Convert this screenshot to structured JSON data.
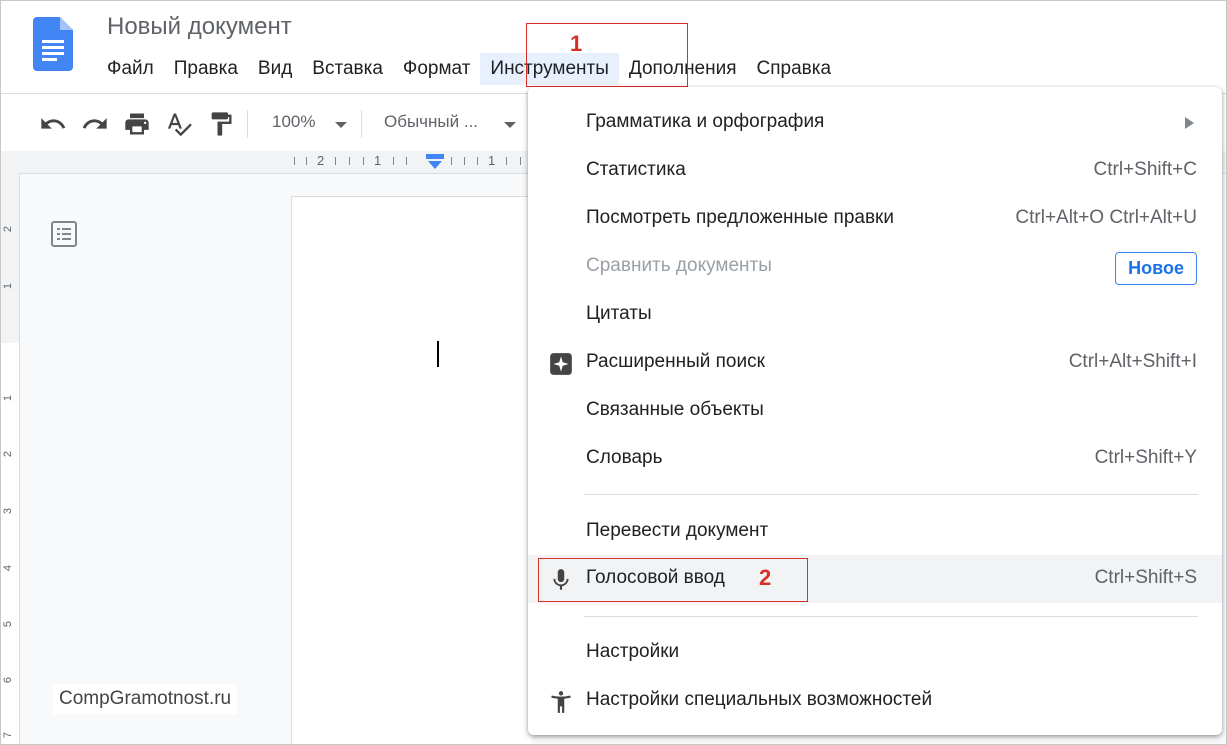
{
  "document": {
    "title": "Новый документ"
  },
  "menubar": {
    "items": [
      {
        "label": "Файл"
      },
      {
        "label": "Правка"
      },
      {
        "label": "Вид"
      },
      {
        "label": "Вставка"
      },
      {
        "label": "Формат"
      },
      {
        "label": "Инструменты",
        "active": true
      },
      {
        "label": "Дополнения"
      },
      {
        "label": "Справка"
      }
    ]
  },
  "annotations": {
    "marker1": "1",
    "marker2": "2",
    "color": "#d93025"
  },
  "toolbar": {
    "zoom": "100%",
    "style": "Обычный ...",
    "icons": [
      "undo-icon",
      "redo-icon",
      "print-icon",
      "spellcheck-icon",
      "paint-format-icon"
    ]
  },
  "ruler": {
    "marks": [
      "2",
      "1",
      "1"
    ]
  },
  "vertical_ruler": {
    "marks": [
      "2",
      "1",
      "1",
      "2",
      "3",
      "4",
      "5",
      "6",
      "7"
    ]
  },
  "tools_menu": {
    "items": [
      {
        "label": "Грамматика и орфография",
        "submenu": true
      },
      {
        "label": "Статистика",
        "shortcut": "Ctrl+Shift+C"
      },
      {
        "label": "Посмотреть предложенные правки",
        "shortcut": "Ctrl+Alt+O Ctrl+Alt+U"
      },
      {
        "label": "Сравнить документы",
        "disabled": true,
        "badge": "Новое"
      },
      {
        "label": "Цитаты"
      },
      {
        "label": "Расширенный поиск",
        "shortcut": "Ctrl+Alt+Shift+I",
        "icon": "explore-sparkle-icon"
      },
      {
        "label": "Связанные объекты"
      },
      {
        "label": "Словарь",
        "shortcut": "Ctrl+Shift+Y"
      },
      {
        "label": "Перевести документ"
      },
      {
        "label": "Голосовой ввод",
        "shortcut": "Ctrl+Shift+S",
        "icon": "microphone-icon",
        "highlighted": true
      },
      {
        "label": "Настройки"
      },
      {
        "label": "Настройки специальных возможностей",
        "icon": "accessibility-icon"
      }
    ]
  },
  "watermark": {
    "text": "CompGramotnost.ru"
  },
  "colors": {
    "accent": "#1a73e8",
    "docs_blue": "#4285f4",
    "annotation": "#d93025"
  }
}
